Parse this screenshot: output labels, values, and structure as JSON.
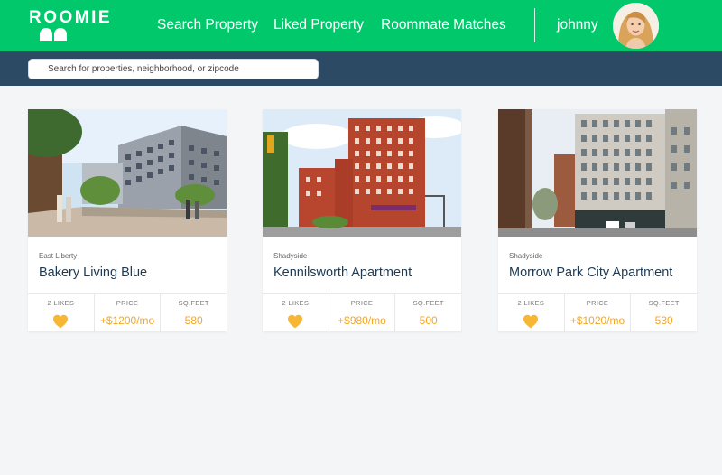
{
  "header": {
    "logo_text": "ROOMIE",
    "nav": {
      "search": "Search Property",
      "liked": "Liked Property",
      "matches": "Roommate Matches"
    },
    "username": "johnny",
    "avatar_icon": "user-avatar"
  },
  "search": {
    "placeholder": "Search for properties, neighborhood, or zipcode",
    "value": ""
  },
  "stat_labels": {
    "price": "PRICE",
    "sqft": "SQ.FEET"
  },
  "listings": [
    {
      "neighborhood": "East Liberty",
      "title": "Bakery Living Blue",
      "likes_label": "2 LIKES",
      "price": "+$1200/mo",
      "sqft": "580"
    },
    {
      "neighborhood": "Shadyside",
      "title": "Kennilsworth Apartment",
      "likes_label": "2 LIKES",
      "price": "+$980/mo",
      "sqft": "500"
    },
    {
      "neighborhood": "Shadyside",
      "title": "Morrow Park City Apartment",
      "likes_label": "2 LIKES",
      "price": "+$1020/mo",
      "sqft": "530"
    }
  ],
  "colors": {
    "brand_green": "#00c86b",
    "search_strip": "#2c4a63",
    "accent_orange": "#f4a623",
    "title_navy": "#1e3a52"
  }
}
